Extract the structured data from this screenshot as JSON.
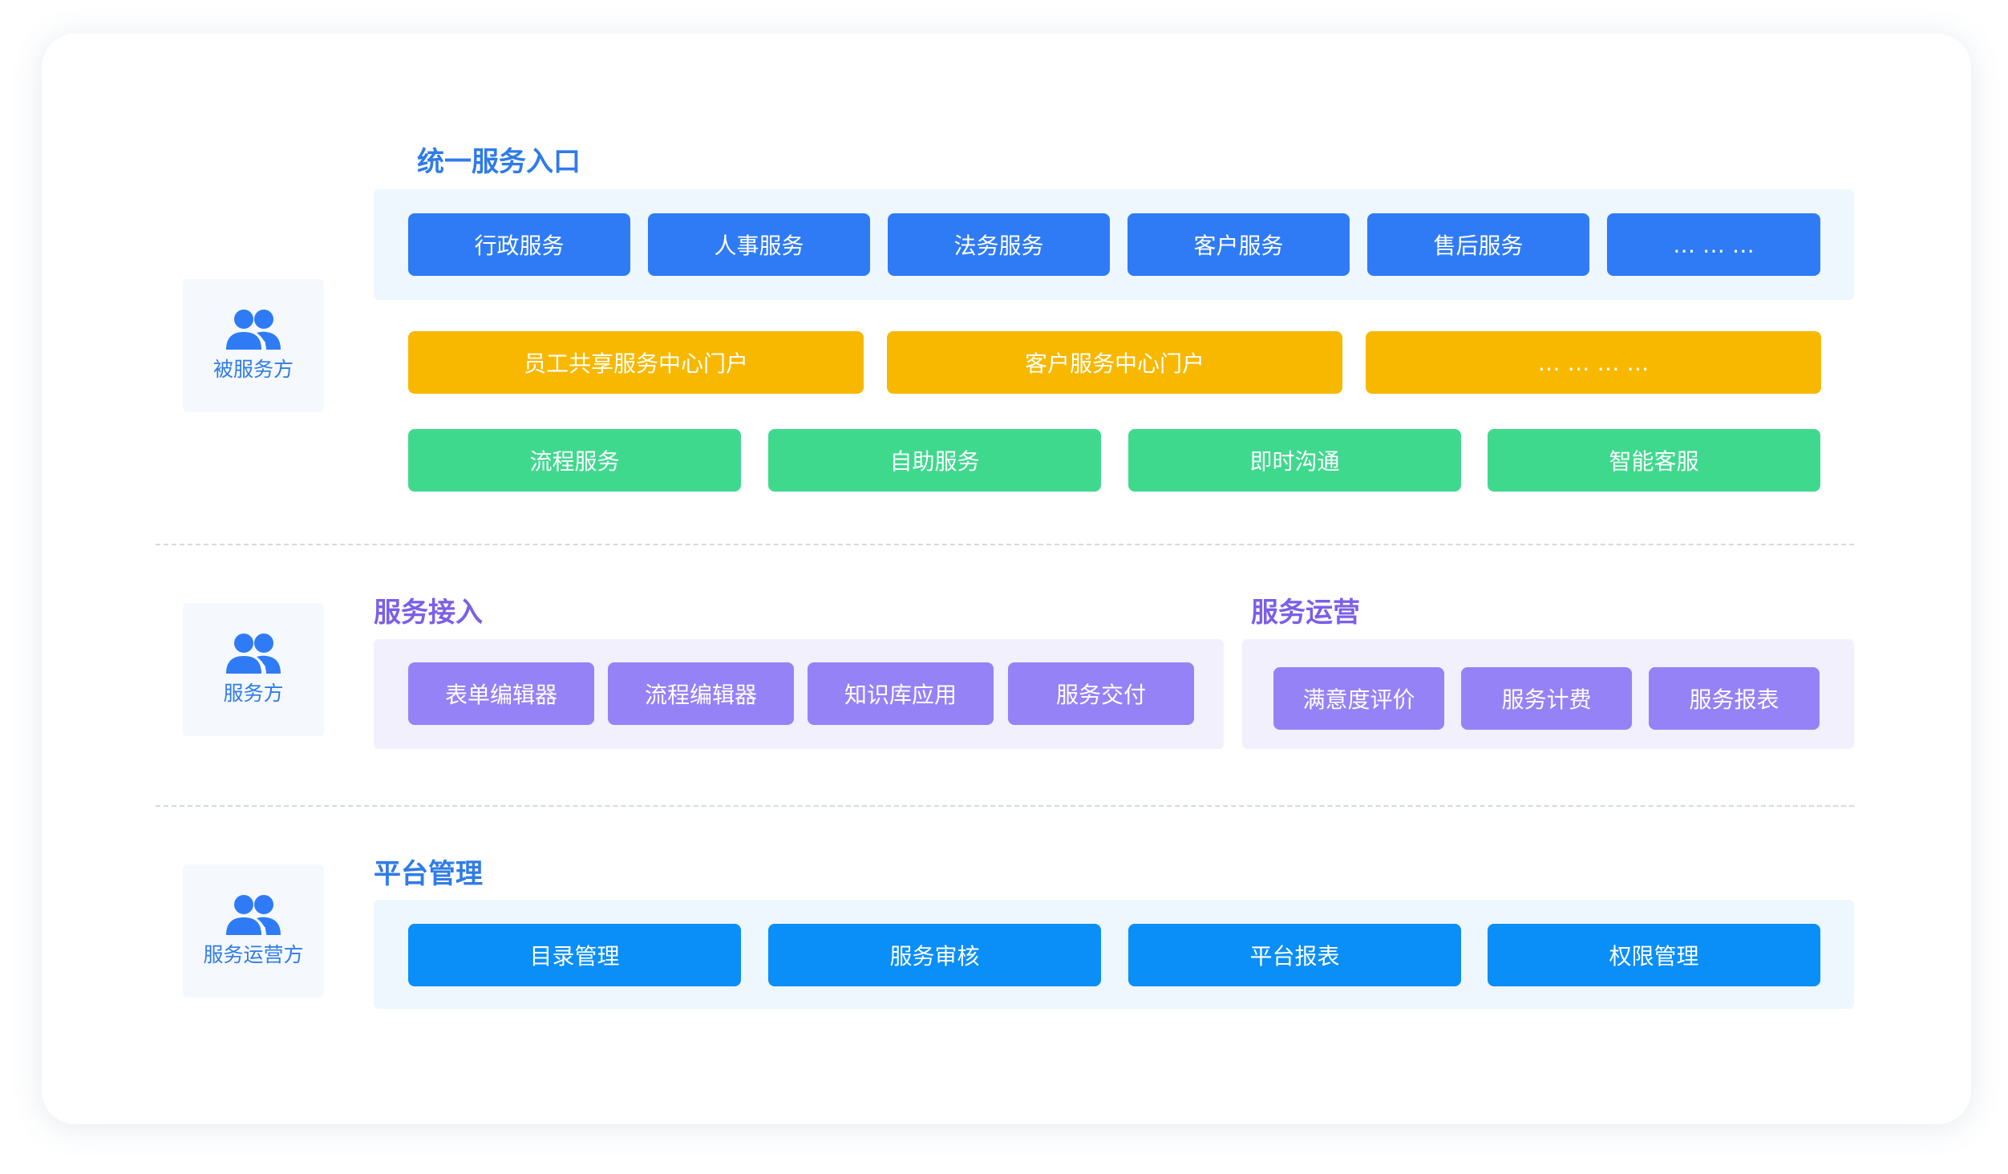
{
  "colors": {
    "blue": "#2f7bf6",
    "yellow": "#f8b800",
    "green": "#3fd98e",
    "purple": "#9582f7",
    "sky": "#0a8ef8",
    "title_blue": "#2f7be9",
    "title_purple": "#7b5fe8"
  },
  "roles": {
    "served": {
      "label": "被服务方",
      "icon": "users-icon"
    },
    "provider": {
      "label": "服务方",
      "icon": "users-icon"
    },
    "operator": {
      "label": "服务运营方",
      "icon": "users-icon"
    }
  },
  "unified_entry": {
    "title": "统一服务入口",
    "services": [
      "行政服务",
      "人事服务",
      "法务服务",
      "客户服务",
      "售后服务",
      "… … …"
    ],
    "portals": [
      "员工共享服务中心门户",
      "客户服务中心门户",
      "… … … …"
    ],
    "channels": [
      "流程服务",
      "自助服务",
      "即时沟通",
      "智能客服"
    ]
  },
  "service_access": {
    "title": "服务接入",
    "items": [
      "表单编辑器",
      "流程编辑器",
      "知识库应用",
      "服务交付"
    ]
  },
  "service_ops": {
    "title": "服务运营",
    "items": [
      "满意度评价",
      "服务计费",
      "服务报表"
    ]
  },
  "platform_mgmt": {
    "title": "平台管理",
    "items": [
      "目录管理",
      "服务审核",
      "平台报表",
      "权限管理"
    ]
  }
}
